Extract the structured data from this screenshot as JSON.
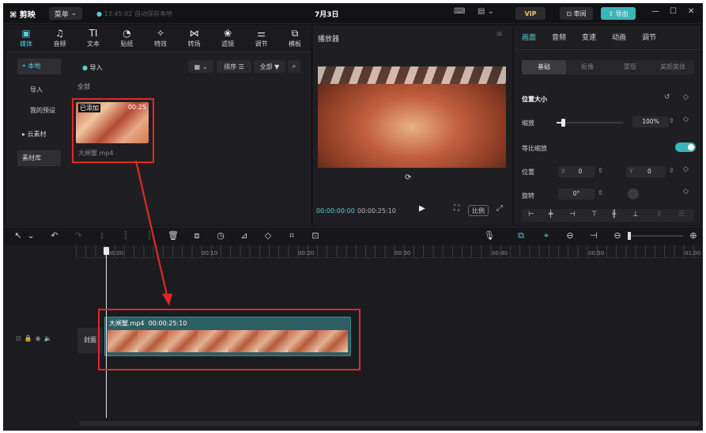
{
  "app": {
    "logo": "剪映",
    "menu": "菜单",
    "save_status": "13:45:02 自动保存本地",
    "project_title": "7月3日"
  },
  "topbar": {
    "vip": "VIP",
    "review": "审阅",
    "export": "导出"
  },
  "media_tabs": [
    {
      "label": "媒体",
      "icon": "▣"
    },
    {
      "label": "音频",
      "icon": "♫"
    },
    {
      "label": "文本",
      "icon": "TI"
    },
    {
      "label": "贴纸",
      "icon": "◔"
    },
    {
      "label": "特效",
      "icon": "✧"
    },
    {
      "label": "转场",
      "icon": "⋈"
    },
    {
      "label": "滤镜",
      "icon": "❀"
    },
    {
      "label": "调节",
      "icon": "⚌"
    },
    {
      "label": "模板",
      "icon": "⧉"
    }
  ],
  "sidebar": {
    "items": [
      {
        "label": "• 本地"
      },
      {
        "label": "导入"
      },
      {
        "label": "我的预设"
      },
      {
        "label": "▸ 云素材"
      },
      {
        "label": "素材库"
      }
    ]
  },
  "media": {
    "import_label": "导入",
    "sort_label": "排序",
    "filter_label": "全部",
    "section": "全部",
    "clip_badge": "已添加",
    "clip_duration": "00:25",
    "clip_name": "大闸蟹.mp4"
  },
  "player": {
    "title": "播放器",
    "current_time": "00:00:00:00",
    "total_time": "00:00:25:10",
    "ratio_label": "比例"
  },
  "inspector": {
    "tabs": [
      "画面",
      "音频",
      "变速",
      "动画",
      "调节"
    ],
    "subtabs": [
      "基础",
      "抠像",
      "蒙版",
      "美颜美体"
    ],
    "section_title": "位置大小",
    "scale_label": "缩放",
    "scale_value": "100%",
    "scale_level": 0.1,
    "uniform_label": "等比缩放",
    "position_label": "位置",
    "pos_x_label": "X",
    "pos_x_value": "0",
    "pos_y_label": "Y",
    "pos_y_value": "0",
    "rotate_label": "旋转",
    "rotate_value": "0°"
  },
  "ruler": [
    "00:00",
    "00:10",
    "00:20",
    "00:30",
    "00:40",
    "00:50",
    "01:00"
  ],
  "track": {
    "cover_label": "封面",
    "clip_label": "大闸蟹.mp4",
    "clip_duration": "00:00:25:10"
  },
  "colors": {
    "accent": "#4fd2d6",
    "annotation": "#e0282a",
    "vip_gold": "#f0c060"
  }
}
